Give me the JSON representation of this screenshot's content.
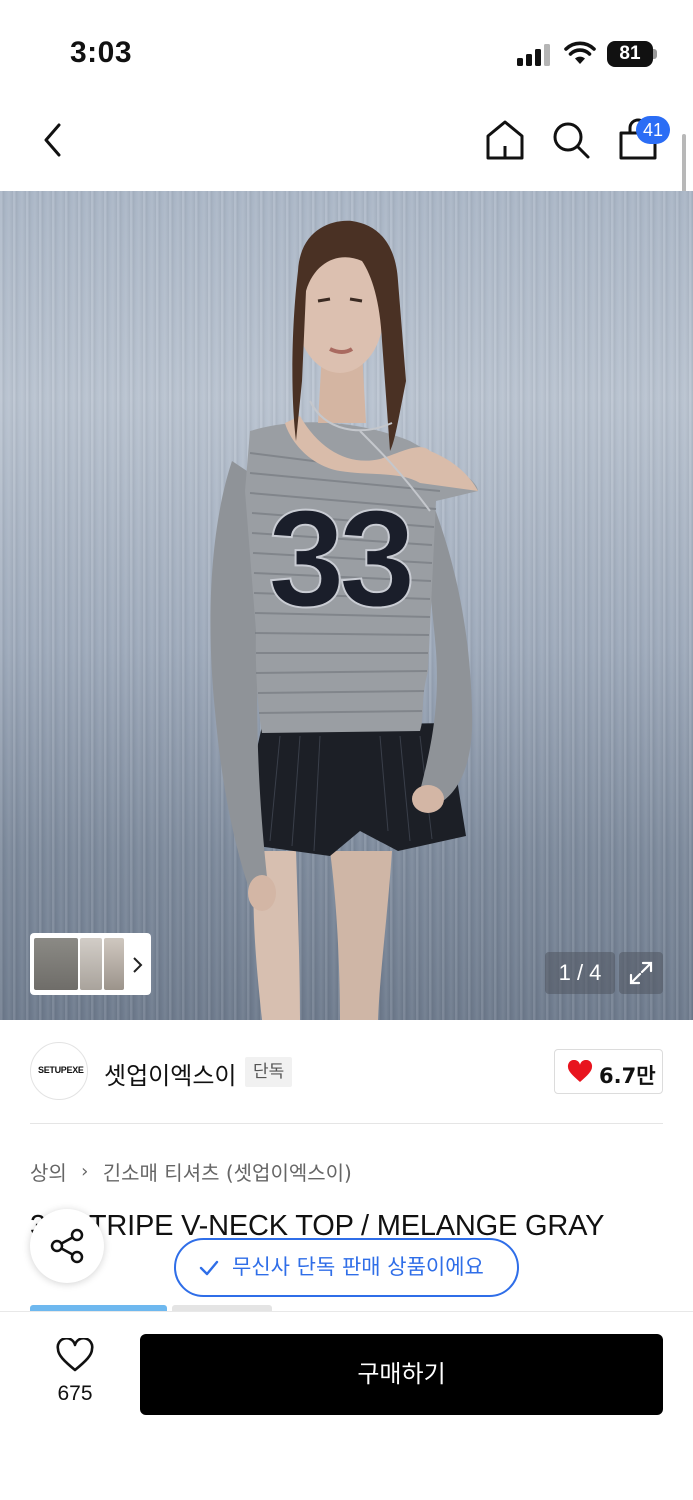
{
  "status_bar": {
    "time": "3:03",
    "battery": "81"
  },
  "nav": {
    "cart_count": "41",
    "icons": [
      "back-arrow-icon",
      "home-icon",
      "search-icon",
      "shopping-bag-icon"
    ]
  },
  "gallery": {
    "page_indicator": "1 / 4",
    "thumbnail_count": 3
  },
  "brand": {
    "logo_text": "SETUPEXE",
    "name": "셋업이엑스이",
    "tag": "단독",
    "likes": "6.7만"
  },
  "breadcrumb": {
    "category": "상의",
    "subcategory": "긴소매 티셔츠 (셋업이엑스이)"
  },
  "product": {
    "title": "33 STRIPE V-NECK TOP / MELANGE GRAY"
  },
  "toast": {
    "text": "무신사 단독 판매 상품이에요"
  },
  "bottom_bar": {
    "wish_count": "675",
    "buy_label": "구매하기"
  },
  "colors": {
    "accent_blue": "#2f6ee8",
    "badge_blue": "#2b6df5",
    "heart_red": "#e8141e",
    "buy_button": "#000000"
  }
}
